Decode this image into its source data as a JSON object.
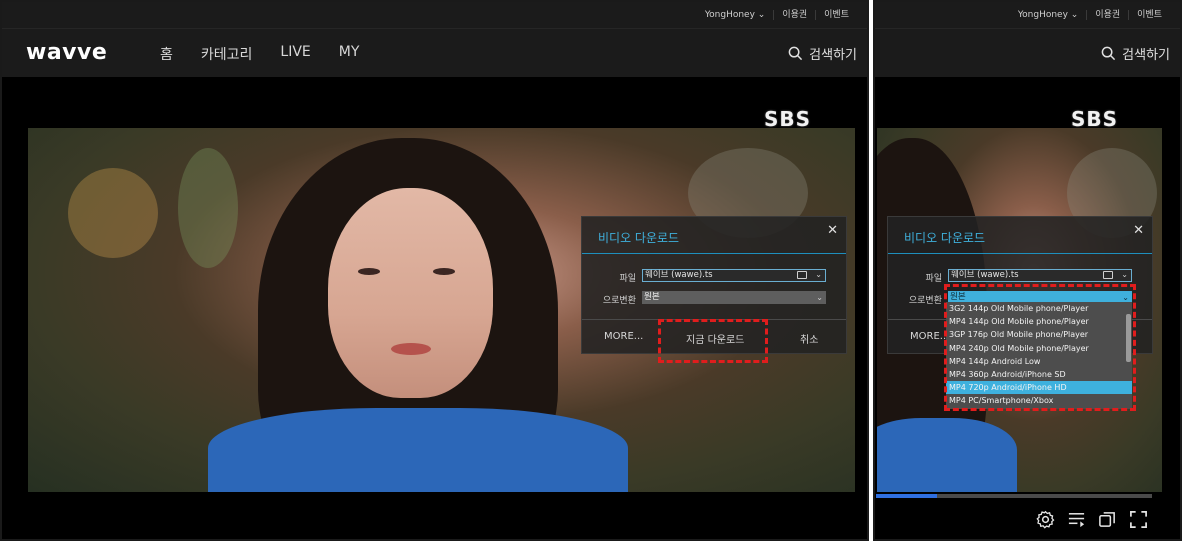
{
  "header": {
    "logo": "wavve",
    "util_links": [
      "YongHoney ⌄",
      "이용권",
      "이벤트"
    ],
    "nav": [
      "홈",
      "카테고리",
      "LIVE",
      "MY"
    ],
    "search_label": "검색하기"
  },
  "video": {
    "broadcaster": "SBS",
    "progress_fraction": 0.22
  },
  "dialog": {
    "title": "비디오 다운로드",
    "close": "✕",
    "file_label": "파일",
    "file_value": "웨이브 (wawe).ts",
    "convert_label": "으로변환",
    "convert_value": "원본",
    "more_button": "MORE...",
    "download_now_button": "지금 다운로드",
    "cancel_button": "취소"
  },
  "format_options": [
    "3G2 144p Old Mobile phone/Player",
    "MP4 144p Old Mobile phone/Player",
    "3GP 176p Old Mobile phone/Player",
    "MP4 240p Old Mobile phone/Player",
    "MP4 144p Android Low",
    "MP4 360p Android/iPhone SD",
    "MP4 720p Android/iPhone HD",
    "MP4 PC/Smartphone/Xbox"
  ],
  "selected_format_index": 6,
  "colors": {
    "accent": "#3fb0dc",
    "highlight_box": "#e01d1d",
    "progress": "#2f6fe0"
  }
}
